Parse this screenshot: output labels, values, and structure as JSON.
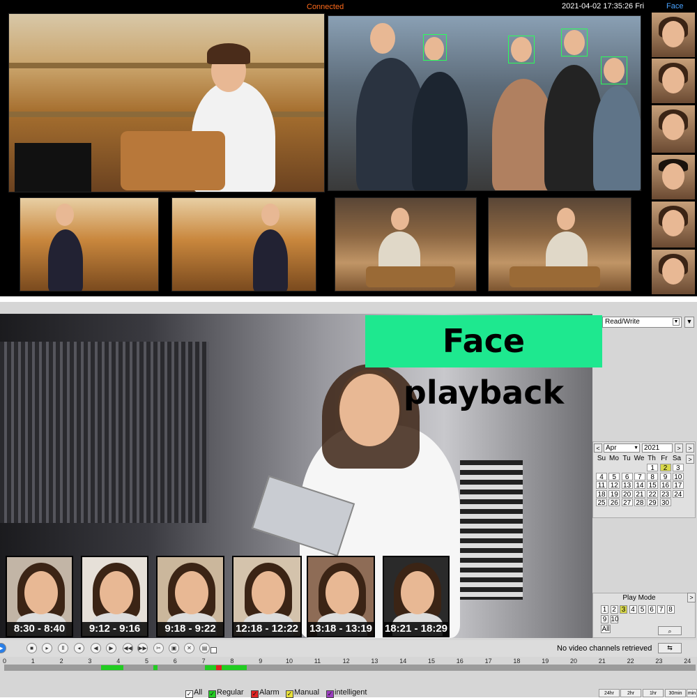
{
  "top": {
    "status": "Connected",
    "datetime": "2021-04-02 17:35:26 Fri",
    "face_label": "Face",
    "colors": {
      "status": "#ff6a1a",
      "face_label": "#4aa3ff",
      "detect_box": "#2cff5a"
    }
  },
  "bottom": {
    "banner": "Face  playback",
    "banner_color": "#1ee88f",
    "mode_select": "Read/Write",
    "calendar": {
      "month": "Apr",
      "year": "2021",
      "weekdays": [
        "Su",
        "Mo",
        "Tu",
        "We",
        "Th",
        "Fr",
        "Sa"
      ],
      "days": [
        "1",
        "2",
        "3",
        "4",
        "5",
        "6",
        "7",
        "8",
        "9",
        "10",
        "11",
        "12",
        "13",
        "14",
        "15",
        "16",
        "17",
        "18",
        "19",
        "20",
        "21",
        "22",
        "23",
        "24",
        "25",
        "26",
        "27",
        "28",
        "29",
        "30"
      ],
      "selected_day": "2"
    },
    "play_mode": {
      "title": "Play Mode",
      "channels": [
        "1",
        "2",
        "3",
        "4",
        "5",
        "6",
        "7",
        "8",
        "9",
        "10"
      ],
      "selected": "3",
      "all": "All"
    },
    "thumbnails": [
      {
        "label": "8:30 - 8:40"
      },
      {
        "label": "9:12 - 9:16"
      },
      {
        "label": "9:18 - 9:22"
      },
      {
        "label": "12:18 - 12:22"
      },
      {
        "label": "13:18 - 13:19"
      },
      {
        "label": "18:21 - 18:29"
      }
    ],
    "status_text": "No video channels retrieved",
    "timeline_ticks": [
      "0",
      "1",
      "2",
      "3",
      "4",
      "5",
      "6",
      "7",
      "8",
      "9",
      "10",
      "11",
      "12",
      "13",
      "14",
      "15",
      "16",
      "17",
      "18",
      "19",
      "20",
      "21",
      "22",
      "23",
      "24"
    ],
    "timeline_end": "24",
    "legend": [
      {
        "label": "All",
        "color": "#ffffff"
      },
      {
        "label": "Regular",
        "color": "#22cc22"
      },
      {
        "label": "Alarm",
        "color": "#dd2222"
      },
      {
        "label": "Manual",
        "color": "#e8e03a"
      },
      {
        "label": "intelligent",
        "color": "#9b3fbf"
      }
    ],
    "zoom_buttons": [
      "24hr",
      "2hr",
      "1hr",
      "30min",
      "min"
    ]
  }
}
